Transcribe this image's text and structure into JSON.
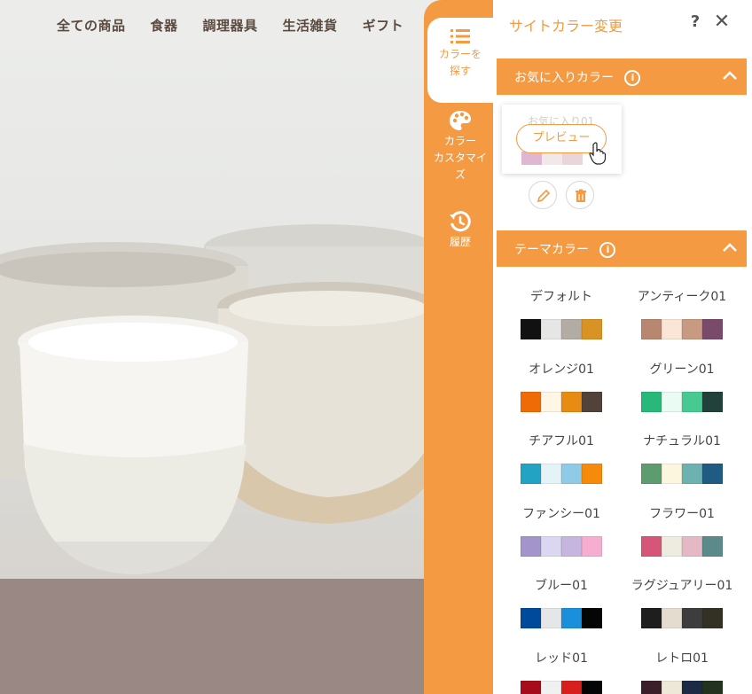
{
  "site": {
    "nav": [
      "全ての商品",
      "食器",
      "調理器具",
      "生活雑貨",
      "ギフト"
    ]
  },
  "tabs": [
    {
      "label_lines": [
        "カラーを",
        "探す"
      ],
      "icon": "list-icon",
      "active": true
    },
    {
      "label_lines": [
        "カラー",
        "カスタマイ",
        "ズ"
      ],
      "icon": "palette-icon",
      "active": false
    },
    {
      "label_lines": [
        "履歴"
      ],
      "icon": "history-icon",
      "active": false
    }
  ],
  "panel": {
    "title": "サイトカラー変更",
    "help": "?",
    "close": "✕",
    "favorites": {
      "header": "お気に入りカラー",
      "item_name": "お気に入り01",
      "preview_label": "プレビュー",
      "swatches": [
        "#dfb7d2",
        "#f1e8ea",
        "#e8d6db",
        "#ffffff"
      ],
      "actions": [
        "pencil-icon",
        "trash-icon"
      ]
    },
    "themes_header": "テーマカラー",
    "themes": [
      {
        "name": "デフォルト",
        "colors": [
          "#111111",
          "#e6e6e4",
          "#b3aca5",
          "#d89324"
        ]
      },
      {
        "name": "アンティーク01",
        "colors": [
          "#b7876f",
          "#fbe5d6",
          "#c89a82",
          "#7a4a6b"
        ]
      },
      {
        "name": "オレンジ01",
        "colors": [
          "#ee6b06",
          "#fff6e6",
          "#e78b13",
          "#51423a"
        ]
      },
      {
        "name": "グリーン01",
        "colors": [
          "#28b97a",
          "#e9fbf3",
          "#47ca91",
          "#22413a"
        ]
      },
      {
        "name": "チアフル01",
        "colors": [
          "#22a3c4",
          "#e3f3f8",
          "#8fcbe6",
          "#f58a0b"
        ]
      },
      {
        "name": "ナチュラル01",
        "colors": [
          "#5d9c6f",
          "#fbf6dd",
          "#6bb2b0",
          "#1f5b82"
        ]
      },
      {
        "name": "ファンシー01",
        "colors": [
          "#a394cc",
          "#dcd7f1",
          "#c6b5df",
          "#f6aed0"
        ]
      },
      {
        "name": "フラワー01",
        "colors": [
          "#d55678",
          "#eeebe0",
          "#e4b8c4",
          "#5c8a8a"
        ]
      },
      {
        "name": "ブルー01",
        "colors": [
          "#004a9c",
          "#e5e6e8",
          "#1a8fdb",
          "#050505"
        ]
      },
      {
        "name": "ラグジュアリー01",
        "colors": [
          "#1e1e1e",
          "#e3dccf",
          "#3d3d3d",
          "#333024"
        ]
      },
      {
        "name": "レッド01",
        "colors": [
          "#a60c1c",
          "#f1f1f1",
          "#d91e1e",
          "#050505"
        ]
      },
      {
        "name": "レトロ01",
        "colors": [
          "#3c1d2a",
          "#eee8d8",
          "#1b2a45",
          "#22331f"
        ]
      }
    ]
  },
  "colors": {
    "accent": "#f39a43"
  }
}
